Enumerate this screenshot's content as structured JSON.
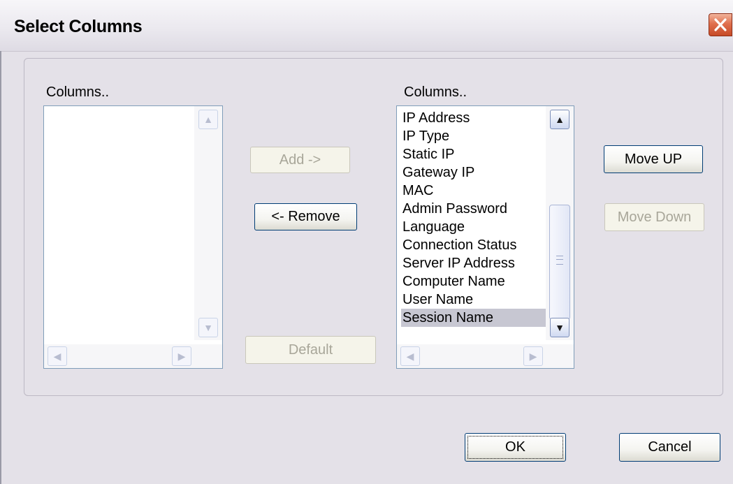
{
  "window": {
    "title": "Select Columns",
    "close_glyph": "✕"
  },
  "left_panel": {
    "label": "Columns..",
    "items": []
  },
  "right_panel": {
    "label": "Columns..",
    "items": [
      {
        "text": "IP Address",
        "selected": false
      },
      {
        "text": "IP Type",
        "selected": false
      },
      {
        "text": "Static IP",
        "selected": false
      },
      {
        "text": "Gateway IP",
        "selected": false
      },
      {
        "text": "MAC",
        "selected": false
      },
      {
        "text": "Admin Password",
        "selected": false
      },
      {
        "text": "Language",
        "selected": false
      },
      {
        "text": "Connection Status",
        "selected": false
      },
      {
        "text": "Server IP Address",
        "selected": false
      },
      {
        "text": "Computer Name",
        "selected": false
      },
      {
        "text": "User Name",
        "selected": false
      },
      {
        "text": "Session Name",
        "selected": true
      }
    ]
  },
  "buttons": {
    "add": {
      "label": "Add ->",
      "enabled": false
    },
    "remove": {
      "label": "<- Remove",
      "enabled": true
    },
    "default": {
      "label": "Default",
      "enabled": false
    },
    "move_up": {
      "label": "Move UP",
      "enabled": true
    },
    "move_down": {
      "label": "Move Down",
      "enabled": false
    },
    "ok": {
      "label": "OK",
      "enabled": true
    },
    "cancel": {
      "label": "Cancel",
      "enabled": true
    }
  },
  "icons": {
    "close": "close-icon",
    "scroll_up": "arrow-up-icon",
    "scroll_down": "arrow-down-icon",
    "scroll_left": "arrow-left-icon",
    "scroll_right": "arrow-right-icon"
  },
  "colors": {
    "dialog_background": "#e4e1e8",
    "close_button": "#d8552f",
    "selection": "#c7c7d2",
    "list_border": "#7f9db9"
  }
}
